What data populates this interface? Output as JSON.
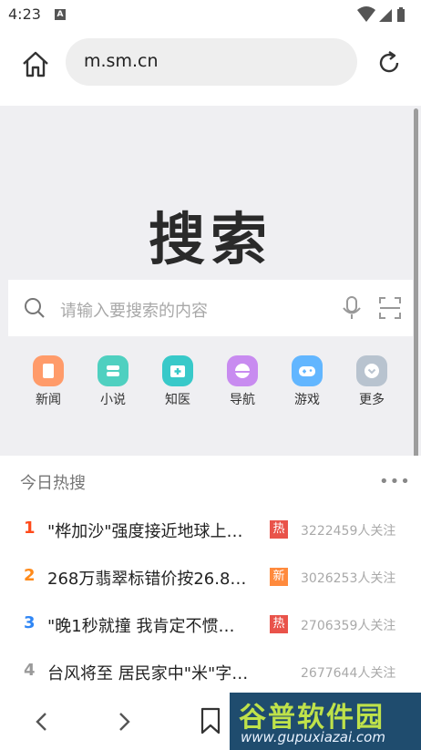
{
  "status": {
    "time": "4:23",
    "badge": "A"
  },
  "browser": {
    "url": "m.sm.cn"
  },
  "hero": {
    "logo": "搜索",
    "search_placeholder": "请输入要搜索的内容",
    "categories": [
      {
        "label": "新闻",
        "color": "#ff9b6a"
      },
      {
        "label": "小说",
        "color": "#4fd0c0"
      },
      {
        "label": "知医",
        "color": "#38c9c9"
      },
      {
        "label": "导航",
        "color": "#c88bf0"
      },
      {
        "label": "游戏",
        "color": "#62b6ff"
      },
      {
        "label": "更多",
        "color": "#b8c3cf"
      }
    ]
  },
  "hot": {
    "title": "今日热搜",
    "more": "•••",
    "items": [
      {
        "rank": "1",
        "rank_color": "#ff4a1a",
        "text": "\"桦加沙\"强度接近地球上…",
        "badge": "热",
        "badge_color": "#e9534a",
        "count": "3222459人关注"
      },
      {
        "rank": "2",
        "rank_color": "#ff8a1a",
        "text": "268万翡翠标错价按26.8…",
        "badge": "新",
        "badge_color": "#ff8a3d",
        "count": "3026253人关注"
      },
      {
        "rank": "3",
        "rank_color": "#2f86f5",
        "text": "\"晚1秒就撞 我肯定不惯…",
        "badge": "热",
        "badge_color": "#e9534a",
        "count": "2706359人关注"
      },
      {
        "rank": "4",
        "rank_color": "#9a9a9a",
        "text": "台风将至 居民家中\"米\"字…",
        "badge": "",
        "badge_color": "#ffffff",
        "count": "2677644人关注"
      }
    ]
  },
  "watermark": {
    "title": "谷普软件园",
    "url": "www.gupuxiazai.com"
  }
}
